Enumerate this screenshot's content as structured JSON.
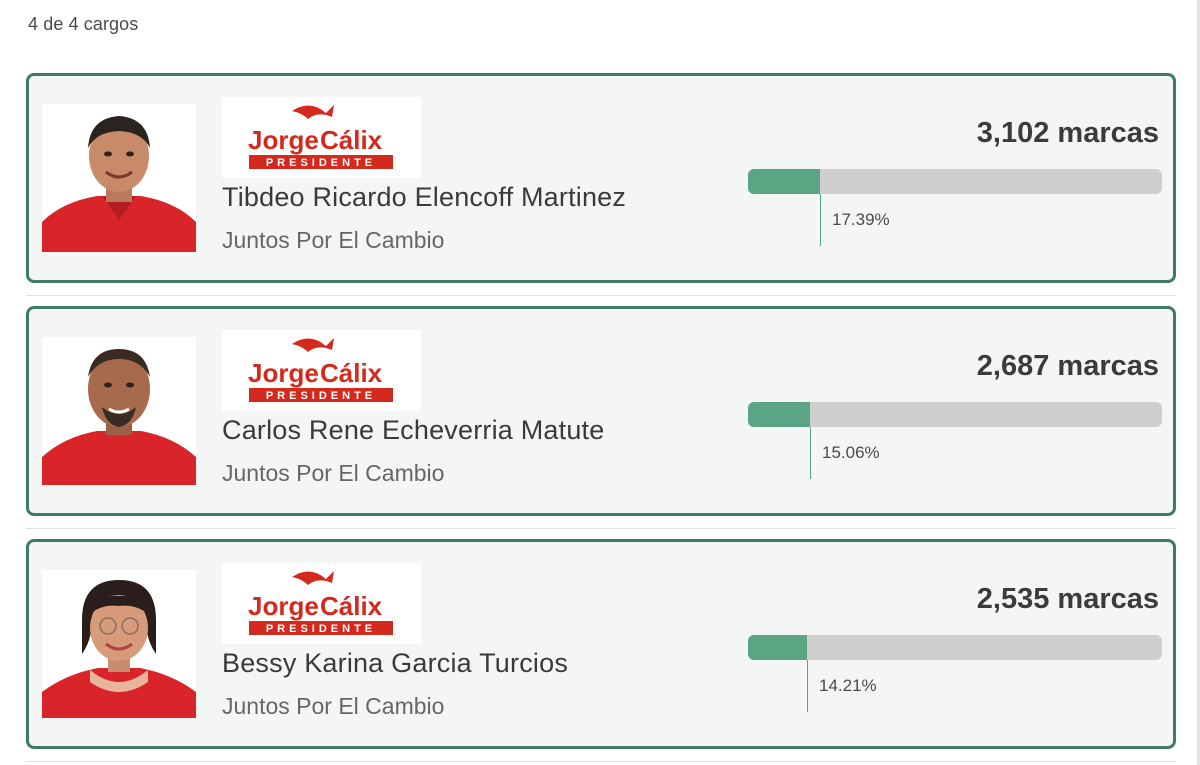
{
  "header": {
    "counter": "4 de 4 cargos"
  },
  "colors": {
    "card_border": "#3e7c67",
    "bar_fill": "#5aa584",
    "bar_track": "#cfcfcf",
    "logo_red": "#d42a1e"
  },
  "logo": {
    "text_first": "Jorge",
    "text_second": "Cálix",
    "subtitle": "PRESIDENTE"
  },
  "candidates": [
    {
      "name": "Tibdeo Ricardo Elencoff Martinez",
      "party": "Juntos Por El Cambio",
      "votes": "3,102 marcas",
      "percent_label": "17.39%",
      "percent": 17.39,
      "photo_icon": "candidate-photo-man"
    },
    {
      "name": "Carlos Rene Echeverria Matute",
      "party": "Juntos Por El Cambio",
      "votes": "2,687 marcas",
      "percent_label": "15.06%",
      "percent": 15.06,
      "photo_icon": "candidate-photo-man"
    },
    {
      "name": "Bessy Karina Garcia Turcios",
      "party": "Juntos Por El Cambio",
      "votes": "2,535 marcas",
      "percent_label": "14.21%",
      "percent": 14.21,
      "photo_icon": "candidate-photo-woman"
    }
  ]
}
